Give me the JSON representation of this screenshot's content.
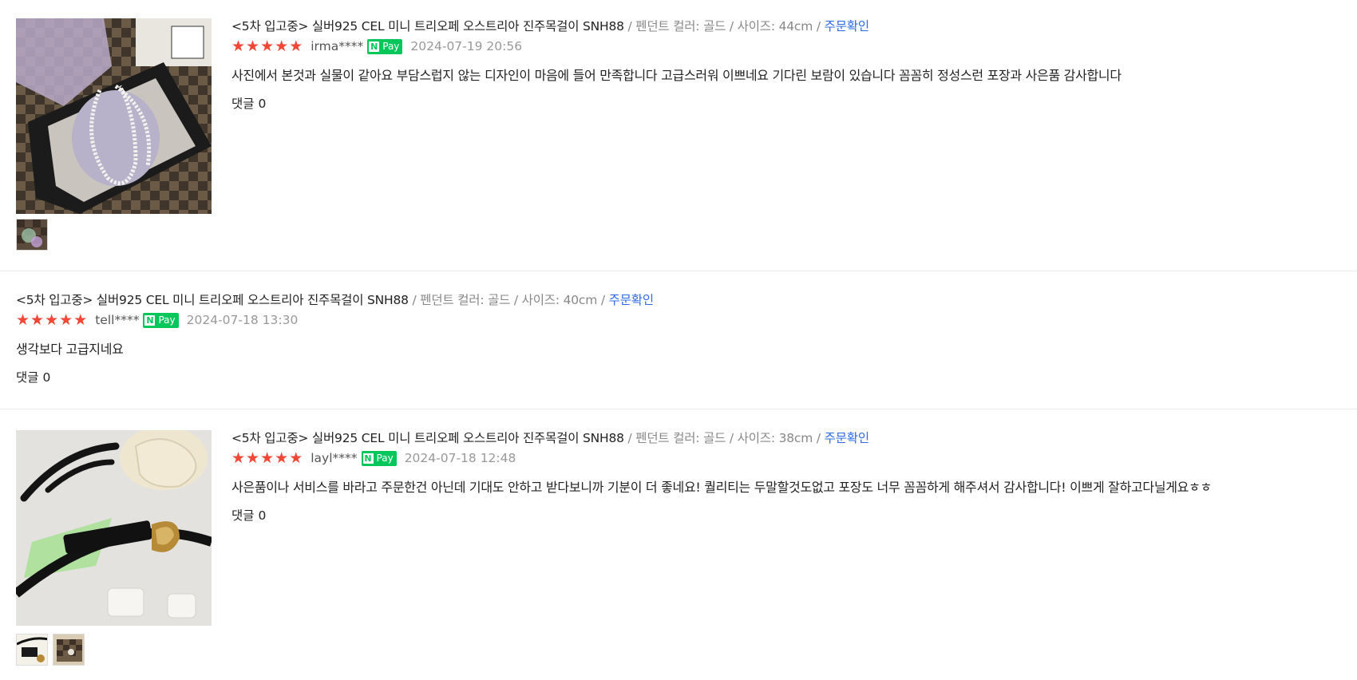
{
  "reviews": [
    {
      "product": "<5차 입고중> 실버925 CEL 미니 트리오페 오스트리아 진주목걸이 SNH88",
      "options": " / 펜던트 컬러: 골드 / 사이즈: 44cm / ",
      "order_link": "주문확인",
      "user": "irma****",
      "pay_badge": "Pay",
      "pay_n": "N",
      "date": "2024-07-19 20:56",
      "text": "사진에서 본것과 실물이 같아요 부담스럽지 않는 디자인이 마음에 들어 만족합니다 고급스러워 이쁘네요 기다린 보람이 있습니다 꼼꼼히 정성스런 포장과 사은품 감사합니다",
      "comments": "댓글 0"
    },
    {
      "product": "<5차 입고중> 실버925 CEL 미니 트리오페 오스트리아 진주목걸이 SNH88",
      "options": " / 펜던트 컬러: 골드 / 사이즈: 40cm / ",
      "order_link": "주문확인",
      "user": "tell****",
      "pay_badge": "Pay",
      "pay_n": "N",
      "date": "2024-07-18 13:30",
      "text": "생각보다 고급지네요",
      "comments": "댓글 0"
    },
    {
      "product": "<5차 입고중> 실버925 CEL 미니 트리오페 오스트리아 진주목걸이 SNH88",
      "options": " / 펜던트 컬러: 골드 / 사이즈: 38cm / ",
      "order_link": "주문확인",
      "user": "layl****",
      "pay_badge": "Pay",
      "pay_n": "N",
      "date": "2024-07-18 12:48",
      "text": "사은품이나 서비스를 바라고 주문한건 아닌데 기대도 안하고 받다보니까 기분이 더 좋네요! 퀄리티는 두말할것도없고 포장도 너무 꼼꼼하게 해주셔서 감사합니다! 이쁘게 잘하고다닐게요ㅎㅎ",
      "comments": "댓글 0"
    }
  ],
  "colors": {
    "star": "#f24637",
    "link": "#2f6ae8",
    "npay": "#03c75a",
    "meta": "#888888"
  }
}
